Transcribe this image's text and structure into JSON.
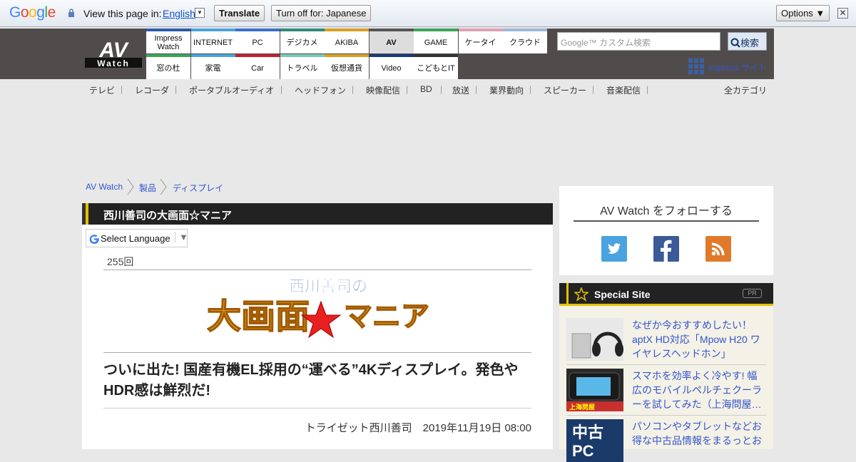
{
  "translate_bar": {
    "logo": "Google",
    "view_text": "View this page in:",
    "language": "English",
    "translate_btn": "Translate",
    "turn_off_btn": "Turn off for: Japanese",
    "options_btn": "Options ▼",
    "close": "✕"
  },
  "site": {
    "logo_top": "AV",
    "logo_bottom": "Watch"
  },
  "nav_top": [
    {
      "label": "Impress Watch",
      "color": "#2a5ca8"
    },
    {
      "label": "INTERNET",
      "color": "#4aa3d8"
    },
    {
      "label": "PC",
      "color": "#3b6ec9"
    },
    {
      "label": "デジカメ",
      "color": "#2f8a7a"
    },
    {
      "label": "AKIBA",
      "color": "#d8a020"
    },
    {
      "label": "AV",
      "color": "#555555"
    },
    {
      "label": "GAME",
      "color": "#3aa55a"
    },
    {
      "label": "ケータイ",
      "color": "#e0a0b0"
    },
    {
      "label": "クラウド",
      "color": "#9ab8d8"
    }
  ],
  "nav_bottom": [
    {
      "label": "窓の杜",
      "color": "#3aa55a"
    },
    {
      "label": "家電",
      "color": "#4aa3d8"
    },
    {
      "label": "Car",
      "color": "#c02030"
    },
    {
      "label": "トラベル",
      "color": "#7ac8b8"
    },
    {
      "label": "仮想通貨",
      "color": "#d8a020"
    },
    {
      "label": "Video",
      "color": "#1a3a7a"
    },
    {
      "label": "こどもとIT",
      "color": "#333333"
    }
  ],
  "search": {
    "placeholder": "Google™ カスタム検索",
    "button": "検索"
  },
  "impress_site": "Impress サイト",
  "subnav": [
    "テレビ",
    "レコーダ",
    "ポータブルオーディオ",
    "ヘッドフォン",
    "映像配信",
    "BD",
    "放送",
    "業界動向",
    "スピーカー",
    "音楽配信"
  ],
  "all_categories": "全カテゴリ",
  "breadcrumb": [
    "AV Watch",
    "製品",
    "ディスプレイ"
  ],
  "section_title": "西川善司の大画面☆マニア",
  "select_language": "Select Language",
  "episode": "255回",
  "banner": {
    "line1": "西川善司の",
    "line2": "大画面",
    "line3": "マニア"
  },
  "article_title": "ついに出た! 国産有機EL採用の“運べる”4Kディスプレイ。発色やHDR感は鮮烈だ!",
  "byline": "トライゼット西川善司　2019年11月19日 08:00",
  "follow": {
    "title": "AV Watch をフォローする",
    "networks": [
      "twitter",
      "facebook",
      "rss"
    ]
  },
  "special_site": {
    "title": "Special Site",
    "pr": "PR",
    "items": [
      {
        "text": "なぜか今おすすめしたい！ aptX HD対応「Mpow H20 ワイヤレスヘッドホン」"
      },
      {
        "text": "スマホを効率よく冷やす! 幅広のモバイルペルチェクーラーを試してみた（上海問屋…"
      },
      {
        "text": "パソコンやタブレットなどお得な中古品情報をまるっとお"
      }
    ]
  }
}
